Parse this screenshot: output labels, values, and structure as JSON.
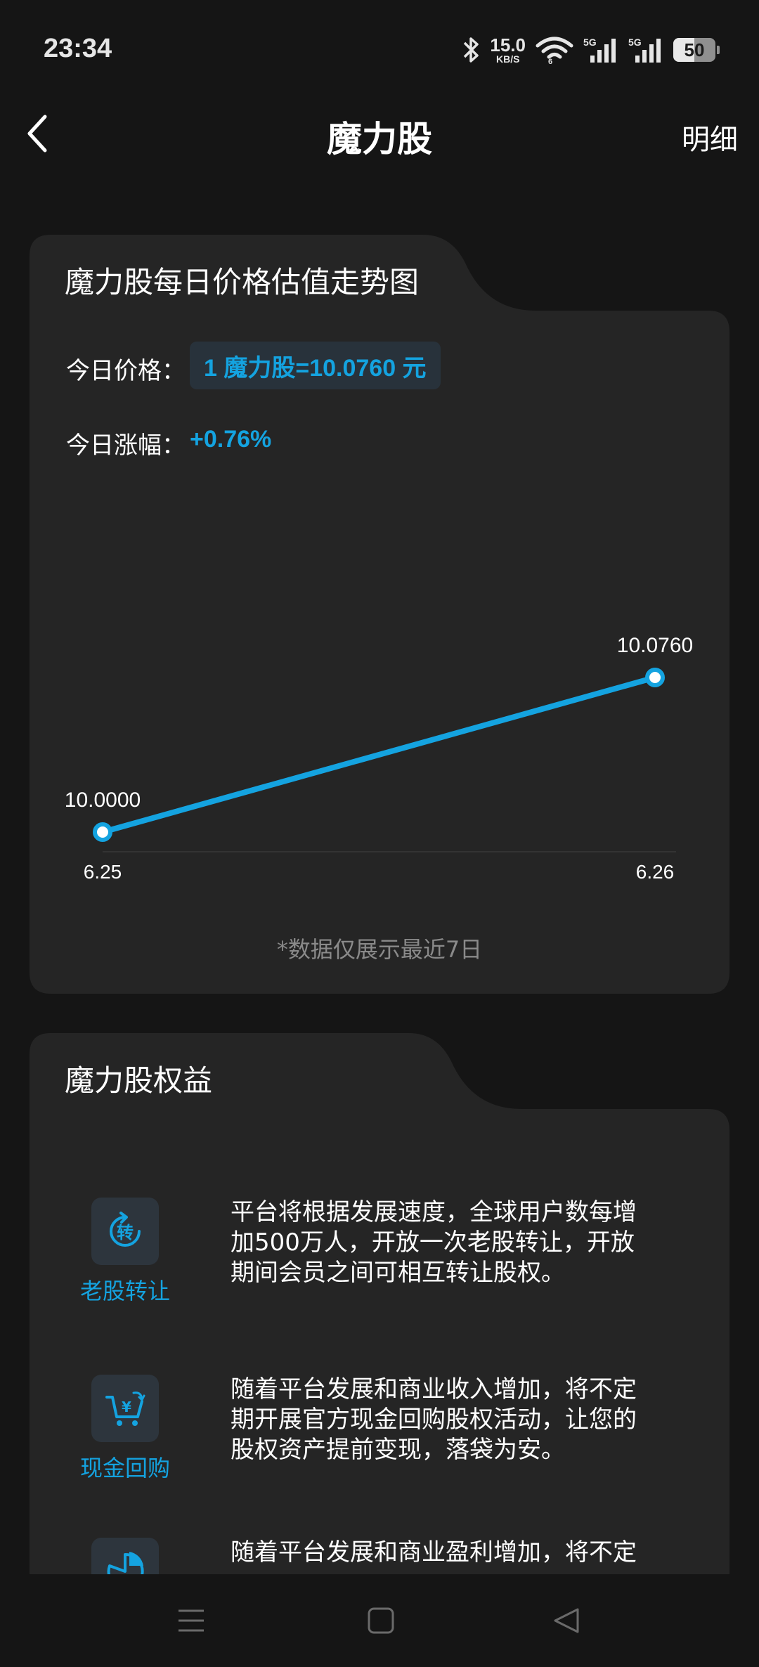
{
  "status_bar": {
    "time": "23:34",
    "net_speed_value": "15.0",
    "net_speed_unit": "KB/S",
    "wifi_sub": "6",
    "signal1_label": "5G",
    "signal2_label": "5G",
    "battery": "50",
    "battery_level": 0.5
  },
  "nav": {
    "title": "魔力股",
    "detail_label": "明细"
  },
  "trend_card": {
    "title": "魔力股每日价格估值走势图",
    "price_label": "今日价格：",
    "price_value": "1 魔力股=10.0760 元",
    "change_label": "今日涨幅：",
    "change_value": "+0.76%",
    "note": "*数据仅展示最近7日"
  },
  "chart_data": {
    "type": "line",
    "categories": [
      "6.25",
      "6.26"
    ],
    "series": [
      {
        "values": [
          10.0,
          10.076
        ],
        "labels": [
          "10.0000",
          "10.0760"
        ]
      }
    ],
    "ylim": [
      10.0,
      10.076
    ],
    "color": "#14a3e0",
    "grid": false
  },
  "benefits_card": {
    "title": "魔力股权益",
    "items": [
      {
        "icon": "transfer-icon",
        "icon_text": "转",
        "name": "老股转让",
        "desc_lines": [
          "平台将根据发展速度，全球用户数每增",
          "加500万人，开放一次老股转让，开放",
          "期间会员之间可相互转让股权。"
        ]
      },
      {
        "icon": "cart-yuan-icon",
        "name": "现金回购",
        "desc_lines": [
          "随着平台发展和商业收入增加，将不定",
          "期开展官方现金回购股权活动，让您的",
          "股权资产提前变现，落袋为安。"
        ]
      },
      {
        "icon": "dividend-icon",
        "name": "",
        "desc_lines": [
          "随着平台发展和商业盈利增加，将不定"
        ]
      }
    ]
  },
  "colors": {
    "accent": "#14a3e0",
    "background": "#151515",
    "card": "#252525"
  }
}
